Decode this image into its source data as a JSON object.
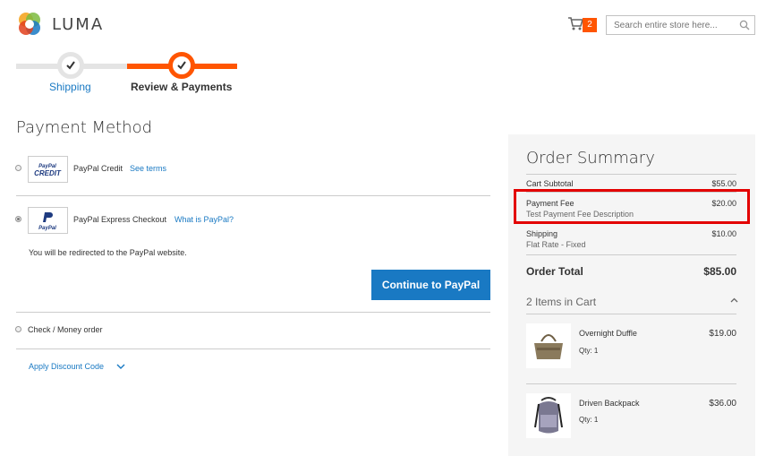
{
  "header": {
    "logo_text": "LUMA",
    "cart_count": "2",
    "search_placeholder": "Search entire store here..."
  },
  "progress": {
    "steps": [
      {
        "label": "Shipping",
        "state": "complete"
      },
      {
        "label": "Review & Payments",
        "state": "active"
      }
    ]
  },
  "payment": {
    "title": "Payment Method",
    "options": [
      {
        "label": "PayPal Credit",
        "link": "See terms",
        "logo": "PayPal CREDIT",
        "selected": false
      },
      {
        "label": "PayPal Express Checkout",
        "link": "What is PayPal?",
        "logo": "PayPal",
        "selected": true
      },
      {
        "label": "Check / Money order",
        "selected": false
      }
    ],
    "redirect_note": "You will be redirected to the PayPal website.",
    "continue_button": "Continue to PayPal",
    "discount_link": "Apply Discount Code"
  },
  "summary": {
    "title": "Order Summary",
    "cart_subtotal_label": "Cart Subtotal",
    "cart_subtotal": "$55.00",
    "fee_label": "Payment Fee",
    "fee_amount": "$20.00",
    "fee_description": "Test Payment Fee Description",
    "shipping_label": "Shipping",
    "shipping_amount": "$10.00",
    "shipping_method": "Flat Rate - Fixed",
    "total_label": "Order Total",
    "total_amount": "$85.00",
    "items_heading": "2 Items in Cart",
    "items": [
      {
        "name": "Overnight Duffle",
        "qty": "Qty: 1",
        "price": "$19.00"
      },
      {
        "name": "Driven Backpack",
        "qty": "Qty: 1",
        "price": "$36.00"
      }
    ]
  },
  "colors": {
    "accent": "#ff5501",
    "link": "#1979c3",
    "highlight": "#e30000"
  }
}
